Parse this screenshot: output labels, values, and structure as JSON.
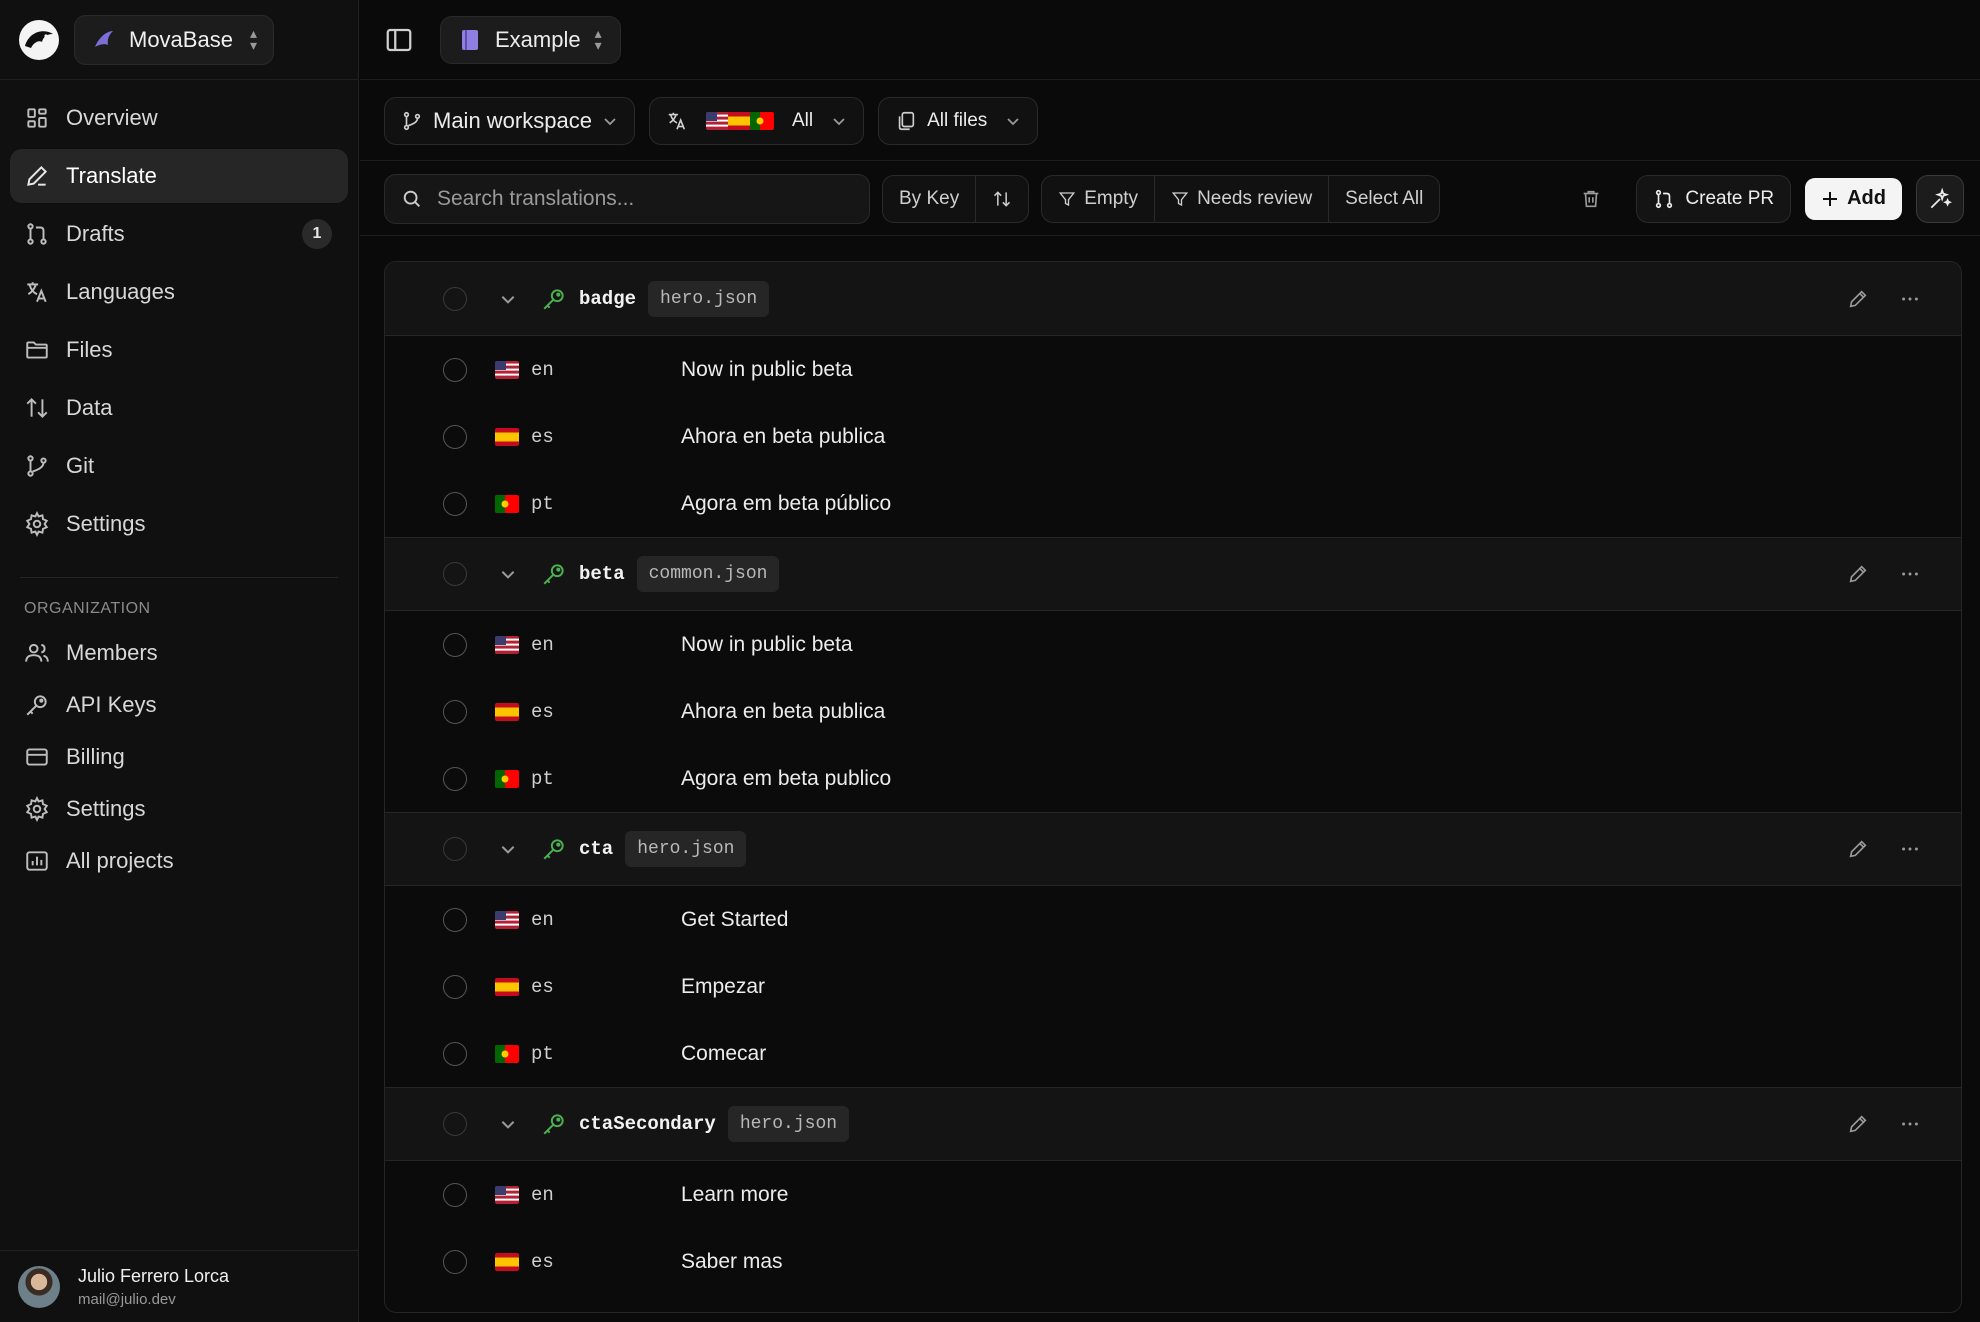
{
  "app": {
    "workspace_name": "MovaBase",
    "project_name": "Example"
  },
  "nav": [
    {
      "label": "Overview",
      "icon": "grid-icon"
    },
    {
      "label": "Translate",
      "icon": "pen-icon",
      "active": true
    },
    {
      "label": "Drafts",
      "icon": "git-pr-icon",
      "badge": "1"
    },
    {
      "label": "Languages",
      "icon": "translate-icon"
    },
    {
      "label": "Files",
      "icon": "folder-icon"
    },
    {
      "label": "Data",
      "icon": "sort-arrows-icon"
    },
    {
      "label": "Git",
      "icon": "git-branch-icon"
    },
    {
      "label": "Settings",
      "icon": "gear-icon"
    }
  ],
  "org": {
    "label": "ORGANIZATION",
    "items": [
      {
        "label": "Members",
        "icon": "users-icon"
      },
      {
        "label": "API Keys",
        "icon": "key-icon"
      },
      {
        "label": "Billing",
        "icon": "card-icon"
      },
      {
        "label": "Settings",
        "icon": "gear-icon"
      },
      {
        "label": "All projects",
        "icon": "chart-icon"
      }
    ]
  },
  "user": {
    "name": "Julio Ferrero Lorca",
    "email": "mail@julio.dev"
  },
  "filters": {
    "branch": "Main workspace",
    "languages": "All",
    "files": "All files"
  },
  "toolbar": {
    "search_placeholder": "Search translations...",
    "by_key": "By Key",
    "empty": "Empty",
    "needs_review": "Needs review",
    "select_all": "Select All",
    "create_pr": "Create PR",
    "add": "Add"
  },
  "groups": [
    {
      "key": "badge",
      "file": "hero.json",
      "rows": [
        {
          "lang": "en",
          "value": "Now in public beta"
        },
        {
          "lang": "es",
          "value": "Ahora en beta publica"
        },
        {
          "lang": "pt",
          "value": "Agora em beta público"
        }
      ]
    },
    {
      "key": "beta",
      "file": "common.json",
      "rows": [
        {
          "lang": "en",
          "value": "Now in public beta"
        },
        {
          "lang": "es",
          "value": "Ahora en beta publica"
        },
        {
          "lang": "pt",
          "value": "Agora em beta publico"
        }
      ]
    },
    {
      "key": "cta",
      "file": "hero.json",
      "rows": [
        {
          "lang": "en",
          "value": "Get Started"
        },
        {
          "lang": "es",
          "value": "Empezar"
        },
        {
          "lang": "pt",
          "value": "Comecar"
        }
      ]
    },
    {
      "key": "ctaSecondary",
      "file": "hero.json",
      "rows": [
        {
          "lang": "en",
          "value": "Learn more"
        },
        {
          "lang": "es",
          "value": "Saber mas"
        }
      ]
    }
  ],
  "colors": {
    "accent_green": "#4caf50",
    "background": "#0a0a0a",
    "active_nav": "#262626"
  }
}
